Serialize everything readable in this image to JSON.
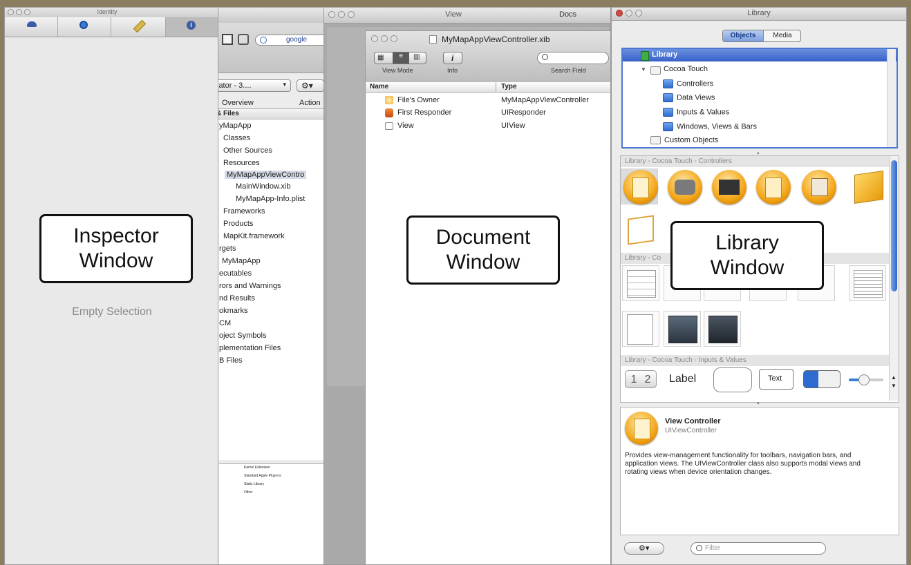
{
  "inspector": {
    "title": "Identity",
    "callout": "Inspector\nWindow",
    "empty": "Empty Selection"
  },
  "xcode": {
    "search": "google",
    "sim_dropdown": "lator - 3....",
    "overview": "Overview",
    "action": "Action",
    "tree": [
      "& Files",
      "yMapApp",
      "Classes",
      "Other Sources",
      "Resources",
      "MyMapAppViewContro",
      "MainWindow.xib",
      "MyMapApp-Info.plist",
      "Frameworks",
      "Products",
      "MapKit.framework",
      "rgets",
      "MyMapApp",
      "ecutables",
      "rors and Warnings",
      "nd Results",
      "okmarks",
      "CM",
      "oject Symbols",
      "plementation Files",
      "B Files"
    ],
    "bottom_list": [
      "Kernel Extension",
      "Standard Apple Plug-ins",
      "Static Library",
      "Other"
    ]
  },
  "view_window": {
    "title": "View",
    "docs": "Docs"
  },
  "document": {
    "title": "MyMapAppViewController.xib",
    "view_mode": "View Mode",
    "info": "Info",
    "search_field": "Search Field",
    "col_name": "Name",
    "col_type": "Type",
    "rows": [
      {
        "name": "File's Owner",
        "type": "MyMapAppViewController"
      },
      {
        "name": "First Responder",
        "type": "UIResponder"
      },
      {
        "name": "View",
        "type": "UIView"
      }
    ],
    "callout": "Document\nWindow"
  },
  "library": {
    "title": "Library",
    "tab_objects": "Objects",
    "tab_media": "Media",
    "tree": {
      "root": "Library",
      "cocoa": "Cocoa Touch",
      "items": [
        "Controllers",
        "Data Views",
        "Inputs & Values",
        "Windows, Views & Bars"
      ],
      "custom": "Custom Objects"
    },
    "section_controllers": "Library - Cocoa Touch - Controllers",
    "section_data": "Library - Co",
    "section_inputs": "Library - Cocoa Touch - Inputs & Values",
    "inputs": {
      "seg1": "1",
      "seg2": "2",
      "label": "Label",
      "text": "Text"
    },
    "callout": "Library\nWindow",
    "detail_title": "View Controller",
    "detail_class": "UIViewController",
    "description": "Provides view-management functionality for toolbars, navigation bars, and application views. The UIViewController class also supports modal views and rotating views when device orientation changes.",
    "filter_placeholder": "Filter"
  }
}
